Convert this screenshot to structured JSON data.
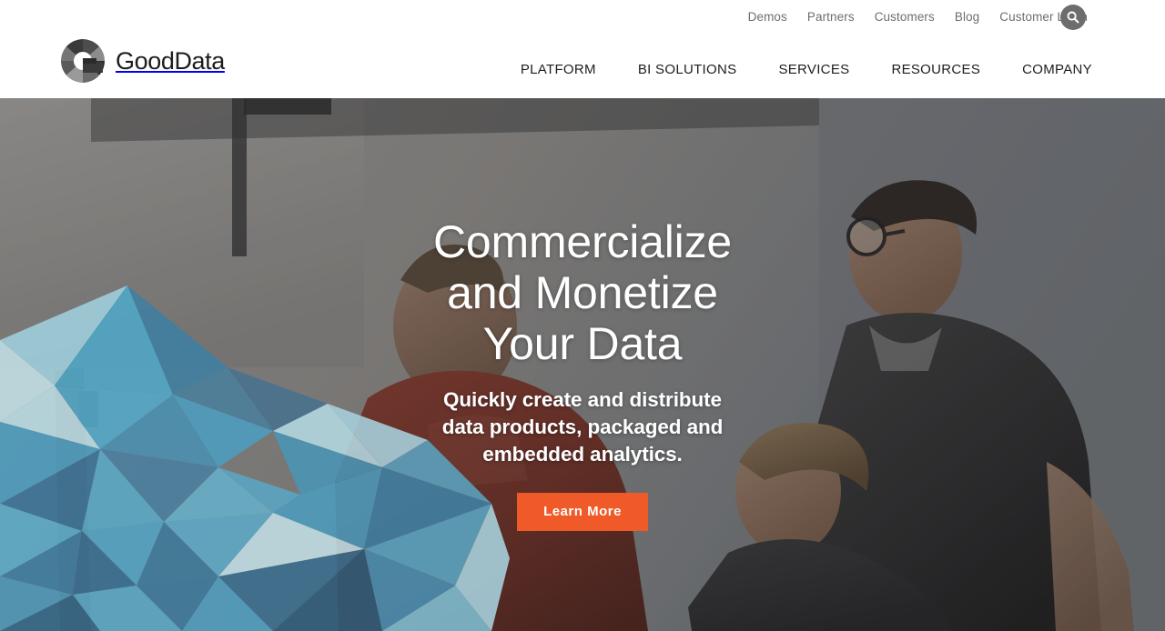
{
  "header": {
    "logo": {
      "icon": "gooddata-logo-mark",
      "text": "GoodData"
    },
    "utility_nav": [
      {
        "label": "Demos"
      },
      {
        "label": "Partners"
      },
      {
        "label": "Customers"
      },
      {
        "label": "Blog"
      },
      {
        "label": "Customer Login"
      }
    ],
    "search": {
      "icon": "search-icon",
      "label": "Search"
    },
    "main_nav": [
      {
        "label": "PLATFORM"
      },
      {
        "label": "BI SOLUTIONS"
      },
      {
        "label": "SERVICES"
      },
      {
        "label": "RESOURCES"
      },
      {
        "label": "COMPANY"
      }
    ]
  },
  "hero": {
    "title_line_1": "Commercialize",
    "title_line_2": "and Monetize",
    "title_line_3": "Your Data",
    "subtitle_line_1": "Quickly create and distribute",
    "subtitle_line_2": "data products, packaged and",
    "subtitle_line_3": "embedded analytics.",
    "cta_label": "Learn More",
    "decoration": "low-poly-blue-mountain-graphic",
    "background": "office-photo-three-men-at-whiteboard"
  },
  "colors": {
    "accent_orange": "#ef5a28",
    "utility_text": "#6e6e6e",
    "nav_text": "#1d1d1d",
    "search_button": "#6d6d6d",
    "poly_pale": "#b7d9e2",
    "poly_light": "#8ec7dc",
    "poly_mid": "#4fa8c8",
    "poly_deep": "#3d6b8c",
    "poly_dark": "#315a76"
  }
}
